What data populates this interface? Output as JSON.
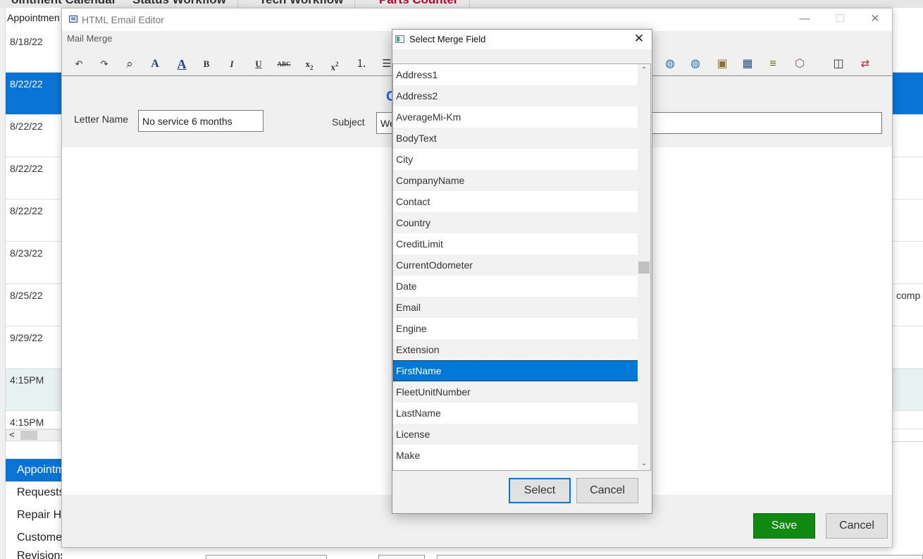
{
  "top_tabs": [
    {
      "label": "ointment Calendar"
    },
    {
      "label": "Status Workflow"
    },
    {
      "label": "Tech Workflow"
    },
    {
      "label": "Parts Counter"
    }
  ],
  "background": {
    "header": "Appointmen",
    "rows": [
      {
        "cell": "8/18/22"
      },
      {
        "cell": "8/22/22"
      },
      {
        "cell": "8/22/22"
      },
      {
        "cell": "8/22/22"
      },
      {
        "cell": "8/22/22"
      },
      {
        "cell": "8/23/22"
      },
      {
        "cell": "8/25/22"
      },
      {
        "cell": "9/29/22"
      },
      {
        "cell": "4:15PM"
      },
      {
        "cell": "4:15PM"
      }
    ],
    "right_text": "comp",
    "scroll_left_arrow": "<",
    "nav": [
      {
        "label": "Appointm"
      },
      {
        "label": "Requests"
      },
      {
        "label": "Repair H"
      },
      {
        "label": "Custome"
      },
      {
        "label": "Revisions of Estimate"
      }
    ]
  },
  "editor": {
    "title": "HTML Email Editor",
    "menu": "Mail Merge",
    "window_buttons": {
      "minimize": "—",
      "maximize": "☐",
      "close": "✕"
    },
    "toolbar": {
      "undo": "↶",
      "redo": "↷",
      "find": "⌕",
      "font": "A",
      "font_color": "A",
      "bold": "B",
      "italic": "I",
      "underline": "U",
      "strike": "ABC",
      "subscript": "x",
      "sub_mark": "2",
      "superscript": "x",
      "sup_mark": "2",
      "ordered_list": "⒈",
      "unordered_list": "☰",
      "globe1": "◍",
      "globe2": "◍",
      "image": "▣",
      "table": "▦",
      "list_tool": "≡",
      "cube": "⬡",
      "chart": "◫",
      "replace": "⇄"
    },
    "letter_name_label": "Letter Name",
    "letter_name_value": "No service 6 months",
    "subject_label": "Subject",
    "subject_value": "We",
    "hidden_heading_glyph": "C",
    "save_label": "Save",
    "cancel_label": "Cancel"
  },
  "dialog": {
    "title": "Select Merge Field",
    "close": "✕",
    "items": [
      {
        "label": "Address1"
      },
      {
        "label": "Address2"
      },
      {
        "label": "AverageMi-Km"
      },
      {
        "label": "BodyText"
      },
      {
        "label": "City"
      },
      {
        "label": "CompanyName"
      },
      {
        "label": "Contact"
      },
      {
        "label": "Country"
      },
      {
        "label": "CreditLimit"
      },
      {
        "label": "CurrentOdometer"
      },
      {
        "label": "Date"
      },
      {
        "label": "Email"
      },
      {
        "label": "Engine"
      },
      {
        "label": "Extension"
      },
      {
        "label": "FirstName"
      },
      {
        "label": "FleetUnitNumber"
      },
      {
        "label": "LastName"
      },
      {
        "label": "License"
      },
      {
        "label": "Make"
      }
    ],
    "selected_item": "FirstName",
    "scroll_up": "⌃",
    "scroll_down": "⌄",
    "select_label": "Select",
    "cancel_label": "Cancel"
  },
  "colors": {
    "selection_blue": "#0078d7",
    "save_green": "#108a10",
    "parts_counter_red": "#c0002a"
  }
}
